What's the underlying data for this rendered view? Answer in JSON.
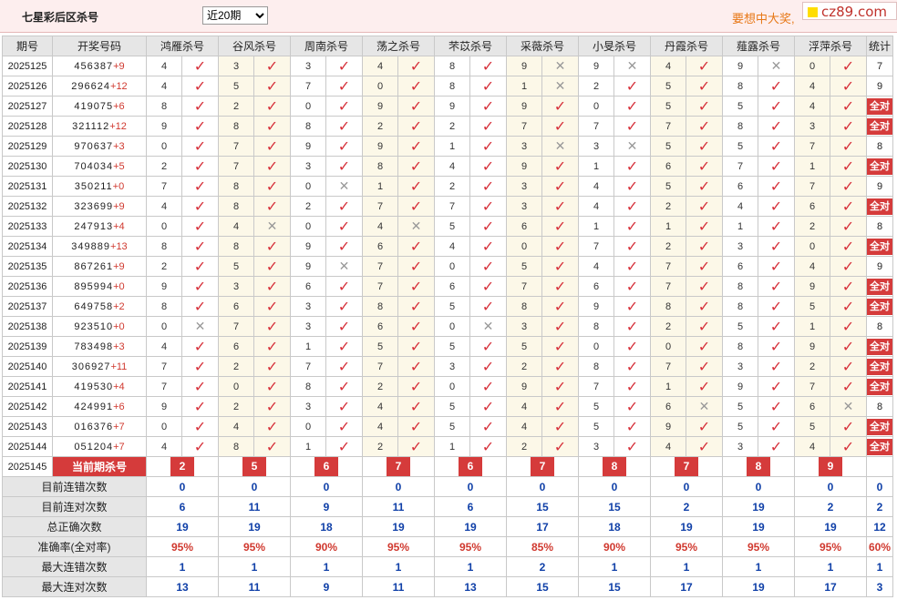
{
  "header": {
    "title": "七星彩后区杀号",
    "period_selected": "近20期",
    "slogan": "要想中大奖,",
    "brand": "cz89.com"
  },
  "columns": {
    "issue": "期号",
    "draw": "开奖号码",
    "stat": "统计",
    "experts": [
      "鸿雁杀号",
      "谷风杀号",
      "周南杀号",
      "荡之杀号",
      "芣苡杀号",
      "采薇杀号",
      "小旻杀号",
      "丹霞杀号",
      "薤露杀号",
      "浮萍杀号"
    ]
  },
  "all_label": "全对",
  "rows": [
    {
      "issue": "2025125",
      "digits": "456387",
      "sum": "+9",
      "picks": [
        "4",
        "3",
        "3",
        "4",
        "8",
        "9",
        "9",
        "4",
        "9",
        "0"
      ],
      "marks": [
        1,
        1,
        1,
        1,
        1,
        0,
        0,
        1,
        0,
        1
      ],
      "stat": "7"
    },
    {
      "issue": "2025126",
      "digits": "296624",
      "sum": "+12",
      "picks": [
        "4",
        "5",
        "7",
        "0",
        "8",
        "1",
        "2",
        "5",
        "8",
        "4"
      ],
      "marks": [
        1,
        1,
        1,
        1,
        1,
        0,
        1,
        1,
        1,
        1
      ],
      "stat": "9"
    },
    {
      "issue": "2025127",
      "digits": "419075",
      "sum": "+6",
      "picks": [
        "8",
        "2",
        "0",
        "9",
        "9",
        "9",
        "0",
        "5",
        "5",
        "4"
      ],
      "marks": [
        1,
        1,
        1,
        1,
        1,
        1,
        1,
        1,
        1,
        1
      ],
      "stat": "all"
    },
    {
      "issue": "2025128",
      "digits": "321112",
      "sum": "+12",
      "picks": [
        "9",
        "8",
        "8",
        "2",
        "2",
        "7",
        "7",
        "7",
        "8",
        "3"
      ],
      "marks": [
        1,
        1,
        1,
        1,
        1,
        1,
        1,
        1,
        1,
        1
      ],
      "stat": "all"
    },
    {
      "issue": "2025129",
      "digits": "970637",
      "sum": "+3",
      "picks": [
        "0",
        "7",
        "9",
        "9",
        "1",
        "3",
        "3",
        "5",
        "5",
        "7"
      ],
      "marks": [
        1,
        1,
        1,
        1,
        1,
        0,
        0,
        1,
        1,
        1
      ],
      "stat": "8"
    },
    {
      "issue": "2025130",
      "digits": "704034",
      "sum": "+5",
      "picks": [
        "2",
        "7",
        "3",
        "8",
        "4",
        "9",
        "1",
        "6",
        "7",
        "1"
      ],
      "marks": [
        1,
        1,
        1,
        1,
        1,
        1,
        1,
        1,
        1,
        1
      ],
      "stat": "all"
    },
    {
      "issue": "2025131",
      "digits": "350211",
      "sum": "+0",
      "picks": [
        "7",
        "8",
        "0",
        "1",
        "2",
        "3",
        "4",
        "5",
        "6",
        "7"
      ],
      "marks": [
        1,
        1,
        0,
        1,
        1,
        1,
        1,
        1,
        1,
        1
      ],
      "stat": "9"
    },
    {
      "issue": "2025132",
      "digits": "323699",
      "sum": "+9",
      "picks": [
        "4",
        "8",
        "2",
        "7",
        "7",
        "3",
        "4",
        "2",
        "4",
        "6"
      ],
      "marks": [
        1,
        1,
        1,
        1,
        1,
        1,
        1,
        1,
        1,
        1
      ],
      "stat": "all"
    },
    {
      "issue": "2025133",
      "digits": "247913",
      "sum": "+4",
      "picks": [
        "0",
        "4",
        "0",
        "4",
        "5",
        "6",
        "1",
        "1",
        "1",
        "2"
      ],
      "marks": [
        1,
        0,
        1,
        0,
        1,
        1,
        1,
        1,
        1,
        1
      ],
      "stat": "8"
    },
    {
      "issue": "2025134",
      "digits": "349889",
      "sum": "+13",
      "picks": [
        "8",
        "8",
        "9",
        "6",
        "4",
        "0",
        "7",
        "2",
        "3",
        "0"
      ],
      "marks": [
        1,
        1,
        1,
        1,
        1,
        1,
        1,
        1,
        1,
        1
      ],
      "stat": "all"
    },
    {
      "issue": "2025135",
      "digits": "867261",
      "sum": "+9",
      "picks": [
        "2",
        "5",
        "9",
        "7",
        "0",
        "5",
        "4",
        "7",
        "6",
        "4"
      ],
      "marks": [
        1,
        1,
        0,
        1,
        1,
        1,
        1,
        1,
        1,
        1
      ],
      "stat": "9"
    },
    {
      "issue": "2025136",
      "digits": "895994",
      "sum": "+0",
      "picks": [
        "9",
        "3",
        "6",
        "7",
        "6",
        "7",
        "6",
        "7",
        "8",
        "9"
      ],
      "marks": [
        1,
        1,
        1,
        1,
        1,
        1,
        1,
        1,
        1,
        1
      ],
      "stat": "all"
    },
    {
      "issue": "2025137",
      "digits": "649758",
      "sum": "+2",
      "picks": [
        "8",
        "6",
        "3",
        "8",
        "5",
        "8",
        "9",
        "8",
        "8",
        "5"
      ],
      "marks": [
        1,
        1,
        1,
        1,
        1,
        1,
        1,
        1,
        1,
        1
      ],
      "stat": "all"
    },
    {
      "issue": "2025138",
      "digits": "923510",
      "sum": "+0",
      "picks": [
        "0",
        "7",
        "3",
        "6",
        "0",
        "3",
        "8",
        "2",
        "5",
        "1"
      ],
      "marks": [
        0,
        1,
        1,
        1,
        0,
        1,
        1,
        1,
        1,
        1
      ],
      "stat": "8"
    },
    {
      "issue": "2025139",
      "digits": "783498",
      "sum": "+3",
      "picks": [
        "4",
        "6",
        "1",
        "5",
        "5",
        "5",
        "0",
        "0",
        "8",
        "9"
      ],
      "marks": [
        1,
        1,
        1,
        1,
        1,
        1,
        1,
        1,
        1,
        1
      ],
      "stat": "all"
    },
    {
      "issue": "2025140",
      "digits": "306927",
      "sum": "+11",
      "picks": [
        "7",
        "2",
        "7",
        "7",
        "3",
        "2",
        "8",
        "7",
        "3",
        "2"
      ],
      "marks": [
        1,
        1,
        1,
        1,
        1,
        1,
        1,
        1,
        1,
        1
      ],
      "stat": "all"
    },
    {
      "issue": "2025141",
      "digits": "419530",
      "sum": "+4",
      "picks": [
        "7",
        "0",
        "8",
        "2",
        "0",
        "9",
        "7",
        "1",
        "9",
        "7"
      ],
      "marks": [
        1,
        1,
        1,
        1,
        1,
        1,
        1,
        1,
        1,
        1
      ],
      "stat": "all"
    },
    {
      "issue": "2025142",
      "digits": "424991",
      "sum": "+6",
      "picks": [
        "9",
        "2",
        "3",
        "4",
        "5",
        "4",
        "5",
        "6",
        "5",
        "6"
      ],
      "marks": [
        1,
        1,
        1,
        1,
        1,
        1,
        1,
        0,
        1,
        0
      ],
      "stat": "8"
    },
    {
      "issue": "2025143",
      "digits": "016376",
      "sum": "+7",
      "picks": [
        "0",
        "4",
        "0",
        "4",
        "5",
        "4",
        "5",
        "9",
        "5",
        "5"
      ],
      "marks": [
        1,
        1,
        1,
        1,
        1,
        1,
        1,
        1,
        1,
        1
      ],
      "stat": "all"
    },
    {
      "issue": "2025144",
      "digits": "051204",
      "sum": "+7",
      "picks": [
        "4",
        "8",
        "1",
        "2",
        "1",
        "2",
        "3",
        "4",
        "3",
        "4"
      ],
      "marks": [
        1,
        1,
        1,
        1,
        1,
        1,
        1,
        1,
        1,
        1
      ],
      "stat": "all"
    }
  ],
  "current": {
    "issue": "2025145",
    "label": "当前期杀号",
    "picks": [
      "2",
      "5",
      "6",
      "7",
      "6",
      "7",
      "8",
      "7",
      "8",
      "9"
    ]
  },
  "summary": [
    {
      "label": "目前连错次数",
      "values": [
        "0",
        "0",
        "0",
        "0",
        "0",
        "0",
        "0",
        "0",
        "0",
        "0"
      ],
      "stat": "0",
      "red": false
    },
    {
      "label": "目前连对次数",
      "values": [
        "6",
        "11",
        "9",
        "11",
        "6",
        "15",
        "15",
        "2",
        "19",
        "2"
      ],
      "stat": "2",
      "red": false
    },
    {
      "label": "总正确次数",
      "values": [
        "19",
        "19",
        "18",
        "19",
        "19",
        "17",
        "18",
        "19",
        "19",
        "19"
      ],
      "stat": "12",
      "red": false
    },
    {
      "label": "准确率(全对率)",
      "values": [
        "95%",
        "95%",
        "90%",
        "95%",
        "95%",
        "85%",
        "90%",
        "95%",
        "95%",
        "95%"
      ],
      "stat": "60%",
      "red": true
    },
    {
      "label": "最大连错次数",
      "values": [
        "1",
        "1",
        "1",
        "1",
        "1",
        "2",
        "1",
        "1",
        "1",
        "1"
      ],
      "stat": "1",
      "red": false
    },
    {
      "label": "最大连对次数",
      "values": [
        "13",
        "11",
        "9",
        "11",
        "13",
        "15",
        "15",
        "17",
        "19",
        "17"
      ],
      "stat": "3",
      "red": false
    }
  ],
  "colors": {
    "accent_red": "#d53b3b",
    "check_red": "#d6303a",
    "summary_blue": "#1040a8",
    "slogan_orange": "#e77817",
    "header_bg": "#fdeeee"
  }
}
